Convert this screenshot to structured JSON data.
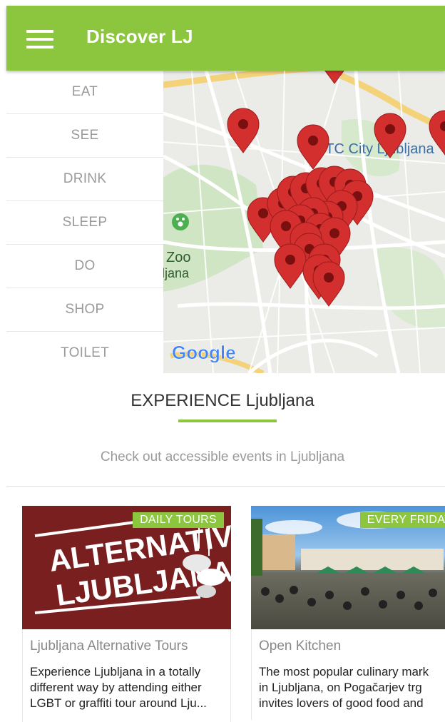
{
  "appbar": {
    "title": "Discover LJ"
  },
  "categories": [
    "EAT",
    "SEE",
    "DRINK",
    "SLEEP",
    "DO",
    "SHOP",
    "TOILET"
  ],
  "map": {
    "labels": {
      "city": "BTC City Ljubljana",
      "zoo": "Zoo",
      "zoo_sub": "ljana",
      "google": "Google"
    }
  },
  "section": {
    "title": "EXPERIENCE Ljubljana",
    "subtitle": "Check out accessible events in Ljubljana"
  },
  "cards": [
    {
      "badge": "DAILY TOURS",
      "image_text_line1": "ALTERNATIVE",
      "image_text_line2": "LJUBLJANA",
      "title": "Ljubljana Alternative Tours",
      "desc_line1": "Experience Ljubljana in a totally",
      "desc_line2": "different way by attending either",
      "desc_line3": "LGBT or graffiti tour around Lju..."
    },
    {
      "badge": "EVERY FRIDAY",
      "title": "Open Kitchen",
      "desc_line1": "The most popular culinary mark",
      "desc_line2": "in Ljubljana, on Pogačarjev trg",
      "desc_line3": "invites lovers of good food and"
    }
  ],
  "colors": {
    "accent": "#8cc63f",
    "pin": "#d32f2f"
  }
}
